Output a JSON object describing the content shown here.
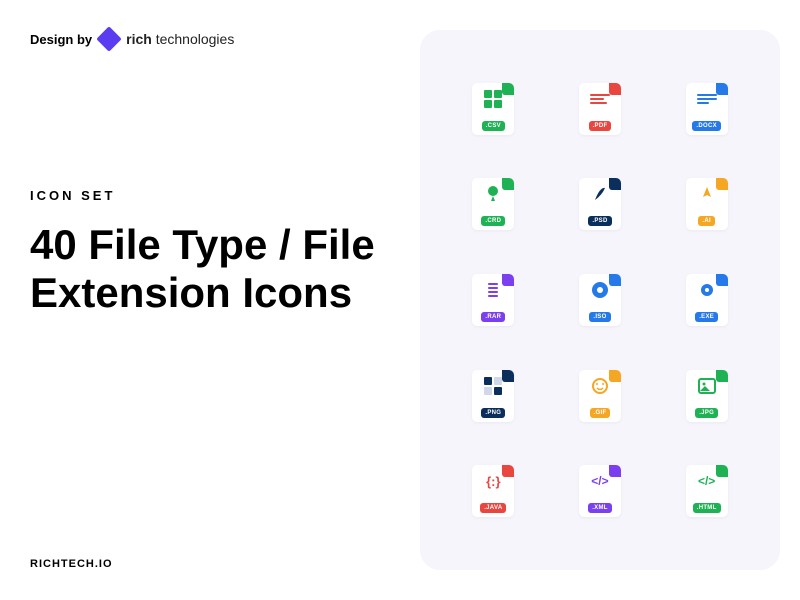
{
  "header": {
    "design_by": "Design by",
    "brand_rich": "rich",
    "brand_tech": " technologies"
  },
  "subtitle": "ICON SET",
  "title": "40 File Type / File Extension Icons",
  "footer": "RICHTECH.IO",
  "icons": [
    {
      "ext": ".CSV",
      "color": "#1fb254"
    },
    {
      "ext": ".PDF",
      "color": "#e8463f"
    },
    {
      "ext": ".DOCX",
      "color": "#2679e8"
    },
    {
      "ext": ".CRD",
      "color": "#1fb254"
    },
    {
      "ext": ".PSD",
      "color": "#0b2f5c"
    },
    {
      "ext": ".AI",
      "color": "#f5a623"
    },
    {
      "ext": ".RAR",
      "color": "#7b3ff0"
    },
    {
      "ext": ".ISO",
      "color": "#2679e8"
    },
    {
      "ext": ".EXE",
      "color": "#2679e8"
    },
    {
      "ext": ".PNG",
      "color": "#0b2f5c"
    },
    {
      "ext": ".GIF",
      "color": "#f5a623"
    },
    {
      "ext": ".JPG",
      "color": "#1fb254"
    },
    {
      "ext": ".JAVA",
      "color": "#e8463f"
    },
    {
      "ext": ".XML",
      "color": "#7b3ff0"
    },
    {
      "ext": ".HTML",
      "color": "#1fb254"
    }
  ]
}
